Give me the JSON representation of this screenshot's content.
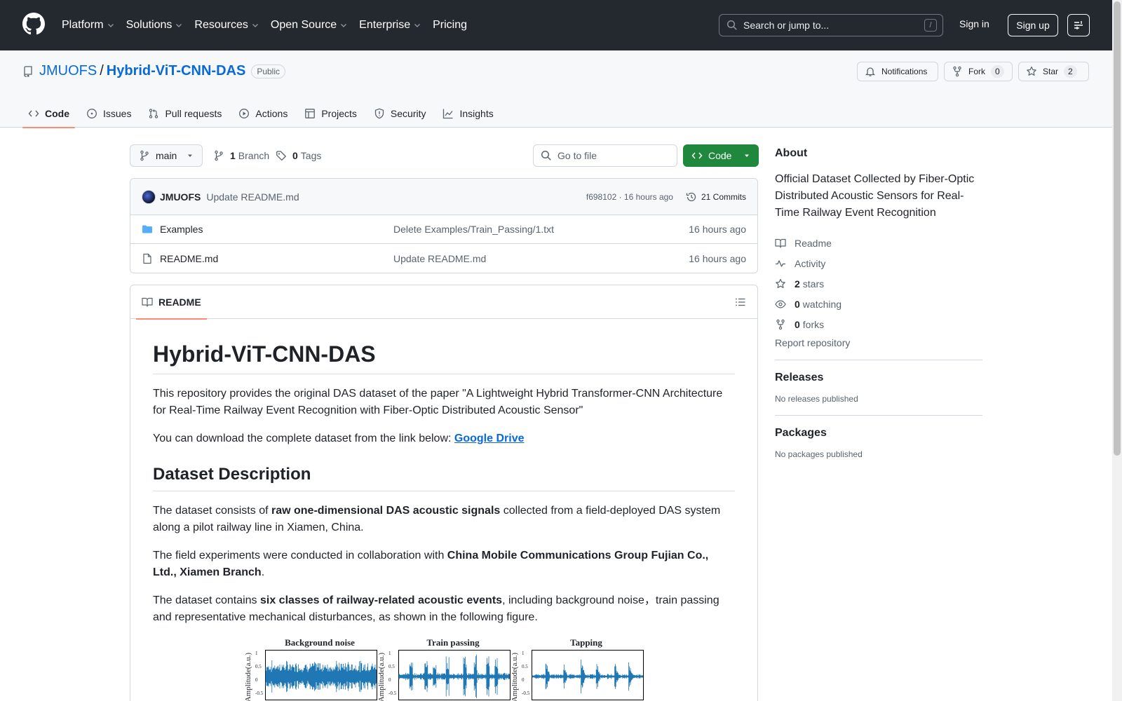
{
  "header": {
    "nav": [
      "Platform",
      "Solutions",
      "Resources",
      "Open Source",
      "Enterprise",
      "Pricing"
    ],
    "search_placeholder": "Search or jump to...",
    "search_shortcut": "/",
    "signin": "Sign in",
    "signup": "Sign up"
  },
  "repo": {
    "owner": "JMUOFS",
    "separator": "/",
    "name": "Hybrid-ViT-CNN-DAS",
    "visibility": "Public",
    "notifications_label": "Notifications",
    "fork_label": "Fork",
    "fork_count": "0",
    "star_label": "Star",
    "star_count": "2"
  },
  "tabs": [
    "Code",
    "Issues",
    "Pull requests",
    "Actions",
    "Projects",
    "Security",
    "Insights"
  ],
  "branch": {
    "current": "main",
    "branch_count": "1",
    "branch_label": "Branch",
    "tag_count": "0",
    "tag_label": "Tags",
    "goto_placeholder": "Go to file",
    "code_button": "Code"
  },
  "commit": {
    "author": "JMUOFS",
    "message": "Update README.md",
    "hash_time": "f698102 · 16 hours ago",
    "commits_label": "21 Commits"
  },
  "files": [
    {
      "name": "Examples",
      "type": "folder",
      "message": "Delete Examples/Train_Passing/1.txt",
      "time": "16 hours ago"
    },
    {
      "name": "README.md",
      "type": "file",
      "message": "Update README.md",
      "time": "16 hours ago"
    }
  ],
  "readme": {
    "tab_label": "README",
    "title": "Hybrid-ViT-CNN-DAS",
    "intro": "This repository provides the original DAS dataset of the paper \"A Lightweight Hybrid Transformer-CNN Architecture for Real-Time Railway Event Recognition with Fiber-Optic Distributed Acoustic Sensor\"",
    "download_text": "You can download the complete dataset from the link below: ",
    "download_link": "Google Drive",
    "section_title": "Dataset Description",
    "p1_a": "The dataset consists of ",
    "p1_b": "raw one-dimensional DAS acoustic signals",
    "p1_c": " collected from a field-deployed DAS system along a pilot railway line in Xiamen, China.",
    "p2_a": "The field experiments were conducted in collaboration with ",
    "p2_b": "China Mobile Communications Group Fujian Co., Ltd., Xiamen Branch",
    "p2_c": ".",
    "p3_a": "The dataset contains ",
    "p3_b": "six classes of railway-related acoustic events",
    "p3_c": ", including background noise，train passing and representative mechanical disturbances, as shown in the following figure.",
    "figure": {
      "panels": [
        "Background noise",
        "Train passing",
        "Tapping"
      ],
      "ylabel": "Amplitude(a.u.)",
      "ticks": [
        "1",
        "0.5",
        "0",
        "-0.5"
      ]
    }
  },
  "about": {
    "title": "About",
    "description": "Official Dataset Collected by Fiber-Optic Distributed Acoustic Sensors for Real-Time Railway Event Recognition",
    "readme": "Readme",
    "activity": "Activity",
    "stars_count": "2",
    "stars_label": "stars",
    "watching_count": "0",
    "watching_label": "watching",
    "forks_count": "0",
    "forks_label": "forks",
    "report": "Report repository"
  },
  "releases": {
    "title": "Releases",
    "note": "No releases published"
  },
  "packages": {
    "title": "Packages",
    "note": "No packages published"
  },
  "colors": {
    "header_bg": "#24292f",
    "link": "#0969da",
    "code_button": "#1f883d",
    "active_tab_underline": "#fd8c73",
    "waveform": "#1f77b4"
  },
  "icons": [
    "github-logo-icon",
    "search-icon",
    "hamburger-icon",
    "repo-icon",
    "bell-icon",
    "fork-icon",
    "star-icon",
    "code-icon",
    "issue-icon",
    "pull-request-icon",
    "play-icon",
    "table-icon",
    "shield-icon",
    "graph-icon",
    "branch-icon",
    "tag-icon",
    "history-icon",
    "folder-icon",
    "file-icon",
    "book-icon",
    "list-icon",
    "pulse-icon",
    "eye-icon"
  ]
}
